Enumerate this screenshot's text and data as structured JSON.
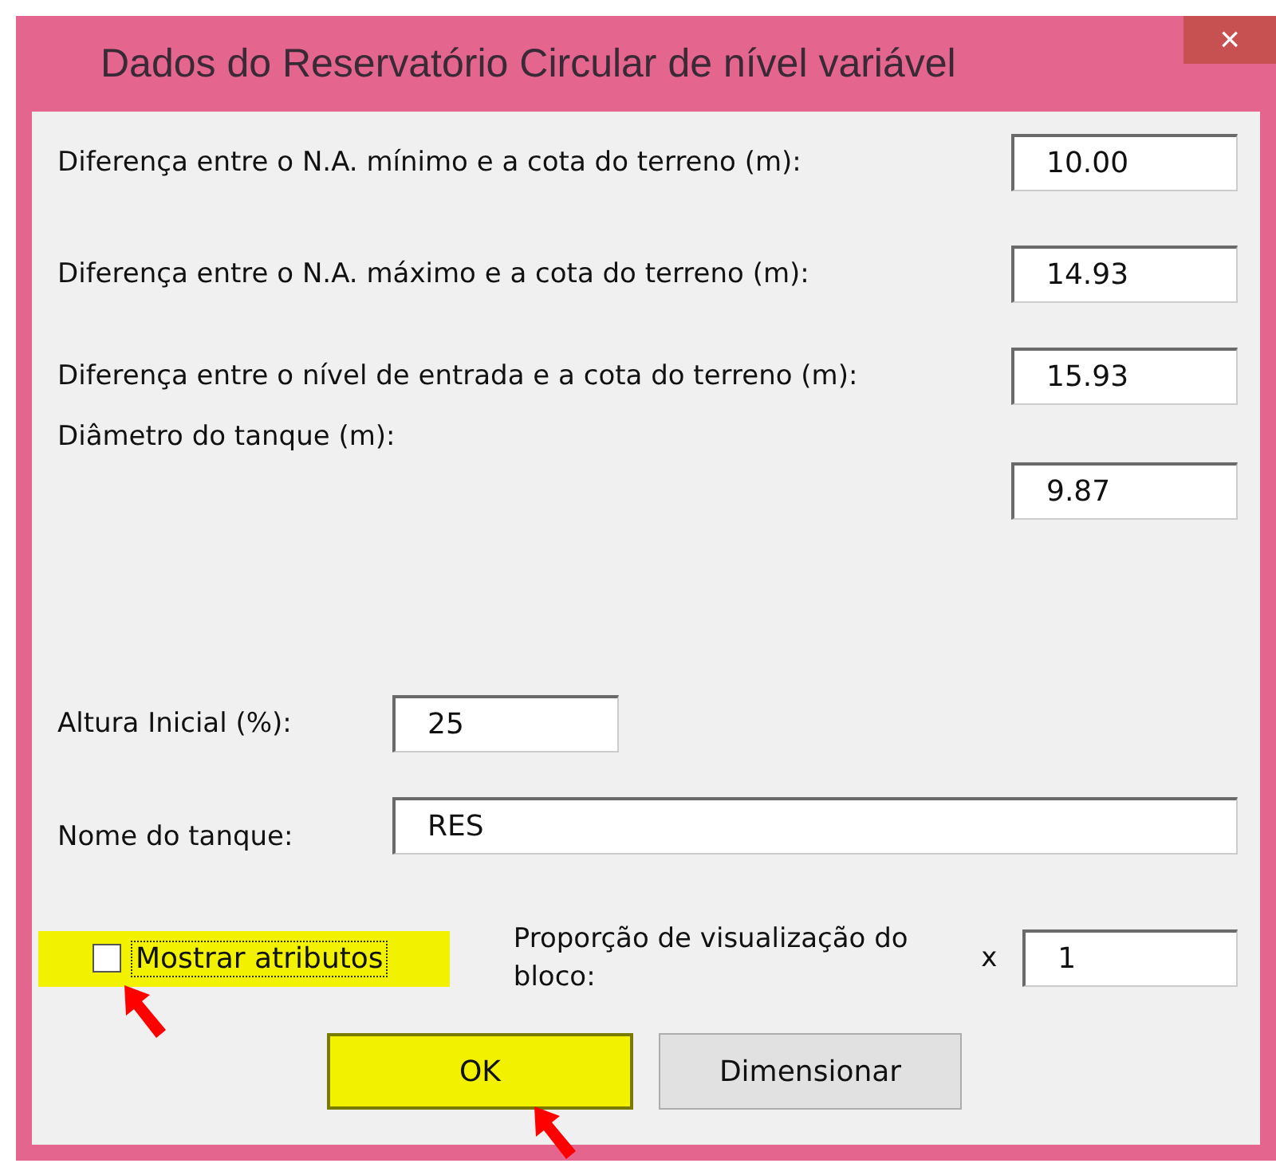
{
  "window": {
    "title": "Dados do Reservatório Circular de nível variável",
    "close": "×"
  },
  "fields": [
    {
      "kind": "right",
      "label": "Diferença entre o N.A. mínimo e a cota do terreno (m):",
      "value": "10.00"
    },
    {
      "kind": "right",
      "label": "Diferença entre o N.A. máximo e a cota do terreno (m):",
      "value": "14.93"
    },
    {
      "kind": "right",
      "label": "Diferença entre o nível de entrada e a cota do terreno (m):",
      "value": "15.93"
    },
    {
      "kind": "below",
      "label": "Diâmetro do tanque (m):",
      "value": "9.87"
    },
    {
      "kind": "short",
      "label": "Altura Inicial (%):",
      "value": "25"
    },
    {
      "kind": "wide",
      "label": "Nome do tanque:",
      "value": "RES"
    }
  ],
  "checkbox": {
    "label": "Mostrar atributos",
    "checked": false
  },
  "proportion": {
    "label": "Proporção de visualização do bloco:",
    "prefix": "x",
    "value": "1"
  },
  "buttons": [
    {
      "label": "OK",
      "default": true
    },
    {
      "label": "Dimensionar",
      "default": false
    }
  ]
}
